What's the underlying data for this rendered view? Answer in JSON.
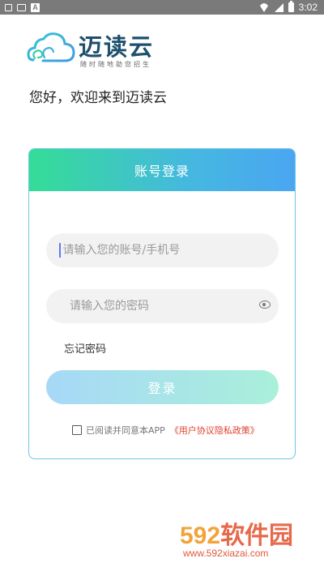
{
  "status_bar": {
    "time": "3:02",
    "icons": [
      "mini-window-icon",
      "image-icon",
      "a-icon",
      "wifi-icon",
      "signal-icon",
      "battery-icon"
    ]
  },
  "brand": {
    "name": "迈读云",
    "slogan": "随时随地助您招生"
  },
  "greeting": "您好，欢迎来到迈读云",
  "login_card": {
    "title": "账号登录",
    "account_field": {
      "placeholder": "请输入您的账号/手机号",
      "value": ""
    },
    "password_field": {
      "placeholder": "请输入您的密码",
      "value": ""
    },
    "forgot_password": "忘记密码",
    "login_button": "登录",
    "agreement": {
      "checked": false,
      "text": "已阅读并同意本APP",
      "link": "《用户协议隐私政策》"
    }
  },
  "watermark": {
    "number": "592",
    "name": "软件园",
    "url": "www.592xiazai.com"
  },
  "colors": {
    "header_gradient_start": "#34dd96",
    "header_gradient_end": "#4aa6f1",
    "button_gradient_start": "#a7d8f7",
    "button_gradient_end": "#a9f0da",
    "link": "#e0422f"
  }
}
